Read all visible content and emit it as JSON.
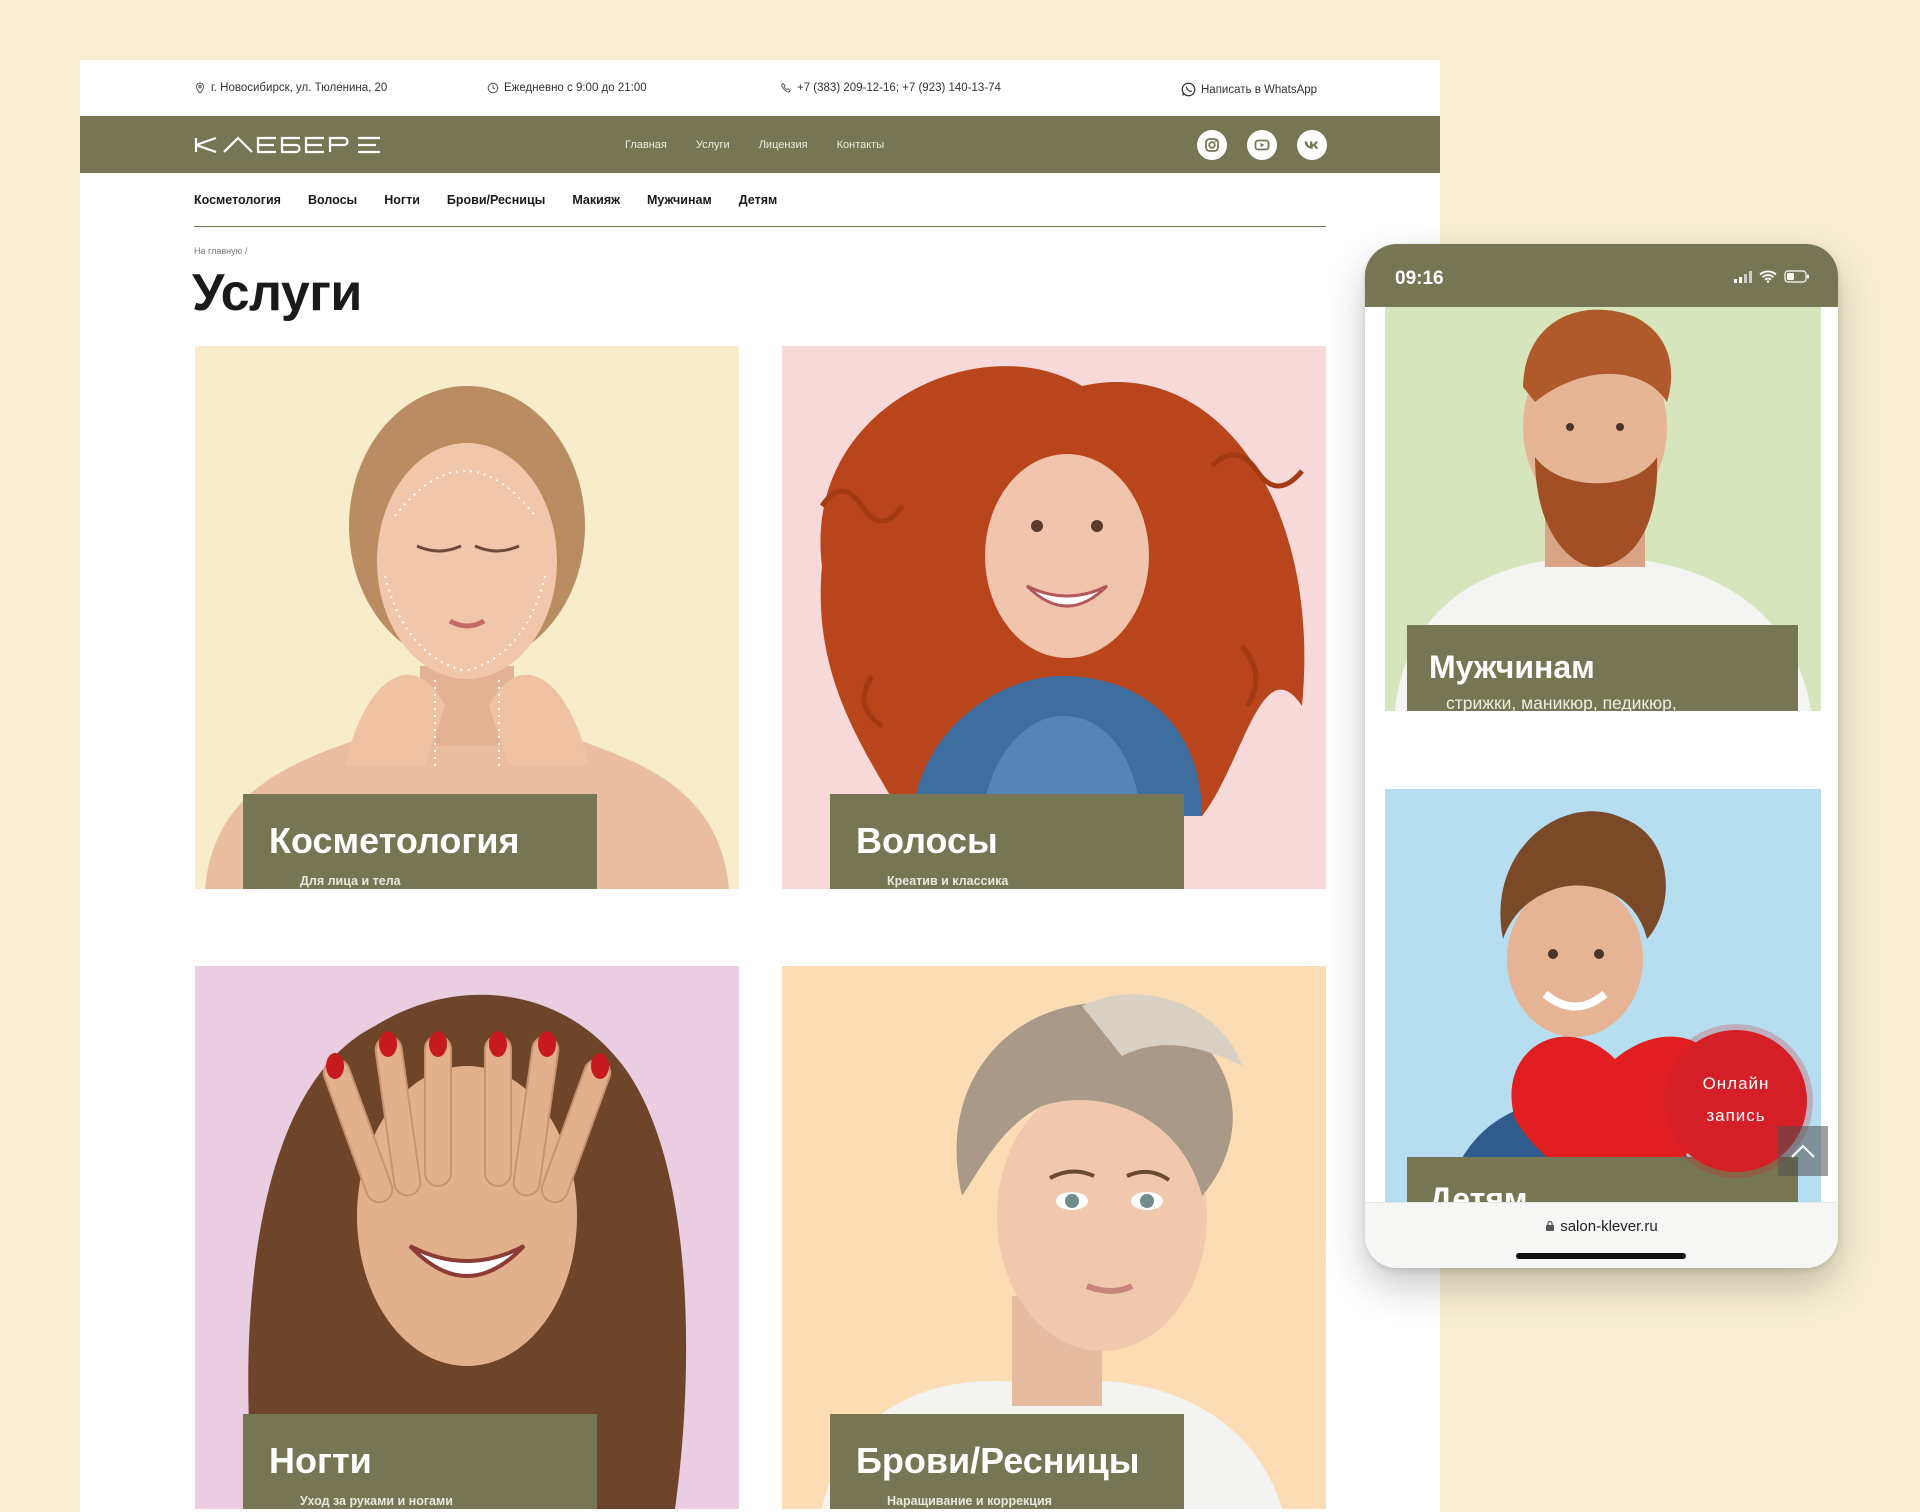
{
  "topbar": {
    "address": "г. Новосибирск, ул. Тюленина, 20",
    "hours": "Ежедневно с 9:00 до 21:00",
    "phones": "+7 (383) 209-12-16;  +7 (923) 140-13-74",
    "whatsapp": "Написать в WhatsApp"
  },
  "logo": "КЛЕВЕР",
  "mainnav": [
    "Главная",
    "Услуги",
    "Лицензия",
    "Контакты"
  ],
  "social": [
    "instagram-icon",
    "youtube-icon",
    "vk-icon"
  ],
  "categories": [
    "Косметология",
    "Волосы",
    "Ногти",
    "Брови/Ресницы",
    "Макияж",
    "Мужчинам",
    "Детям"
  ],
  "breadcrumb": "На главную  /",
  "page_title": "Услуги",
  "cards": [
    {
      "title": "Косметология",
      "subtitle": "Для лица и тела",
      "bg": "#f8edcb"
    },
    {
      "title": "Волосы",
      "subtitle": "Креатив и классика",
      "bg": "#f6d9d8"
    },
    {
      "title": "Ногти",
      "subtitle": "Уход за руками и ногами",
      "bg": "#ebcde2"
    },
    {
      "title": "Брови/Ресницы",
      "subtitle": "Наращивание и коррекция",
      "bg": "#fbdcb5"
    }
  ],
  "mobile": {
    "time": "09:16",
    "cards": [
      {
        "title": "Мужчинам",
        "subtitle": "стрижки, маникюр, педикюр, косметология",
        "bg": "#d6e5bb"
      },
      {
        "title": "Детям",
        "subtitle": "",
        "bg": "#b6def0"
      }
    ],
    "online_button": [
      "Онлайн",
      "запись"
    ],
    "url": "salon-klever.ru"
  },
  "colors": {
    "brand": "#767654",
    "page_bg": "#f8efd2",
    "accent_red": "#d31f25"
  }
}
